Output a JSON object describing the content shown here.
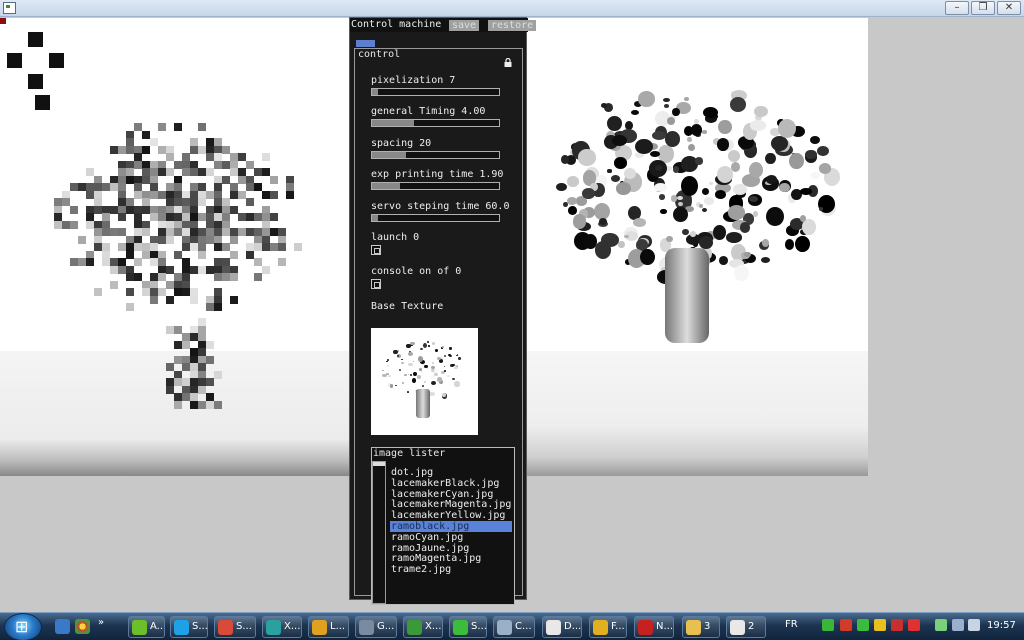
{
  "window": {
    "title": "",
    "controls": {
      "minimize": "–",
      "maximize": "❒",
      "close": "✕"
    }
  },
  "panel": {
    "title": "Control machine",
    "save_label": "save",
    "restore_label": "restore",
    "group_label": "control",
    "controls": [
      {
        "type": "slider",
        "label": "pixelization 7",
        "fraction": 0.05
      },
      {
        "type": "slider",
        "label": "general Timing 4.00",
        "fraction": 0.33
      },
      {
        "type": "slider",
        "label": "spacing 20",
        "fraction": 0.27
      },
      {
        "type": "slider",
        "label": "exp printing time 1.90",
        "fraction": 0.22
      },
      {
        "type": "slider",
        "label": "servo steping time 60.0",
        "fraction": 0.05
      },
      {
        "type": "checkbox",
        "label": "launch 0",
        "checked": false
      },
      {
        "type": "checkbox",
        "label": "console on of 0",
        "checked": false
      }
    ],
    "texture_label": "Base Texture",
    "lister": {
      "label": "image lister",
      "items": [
        "dot.jpg",
        "lacemakerBlack.jpg",
        "lacemakerCyan.jpg",
        "lacemakerMagenta.jpg",
        "lacemakerYellow.jpg",
        "ramoblack.jpg",
        "ramoCyan.jpg",
        "ramoJaune.jpg",
        "ramoMagenta.jpg",
        "trame2.jpg"
      ],
      "selected": "ramoblack.jpg"
    }
  },
  "taskbar": {
    "items": [
      {
        "label": "A...",
        "icon": "dreamweaver-icon",
        "color": "#6bbf2a"
      },
      {
        "label": "S...",
        "icon": "skype-icon",
        "color": "#1ea1e6"
      },
      {
        "label": "S...",
        "icon": "app-icon",
        "color": "#d94a3a"
      },
      {
        "label": "X...",
        "icon": "arduino-icon",
        "color": "#2aa0a0"
      },
      {
        "label": "L...",
        "icon": "media-icon",
        "color": "#e0a020"
      },
      {
        "label": "G...",
        "icon": "app-icon",
        "color": "#7a8aa0"
      },
      {
        "label": "X...",
        "icon": "xcode-icon",
        "color": "#3a9a3a"
      },
      {
        "label": "S...",
        "icon": "spotify-icon",
        "color": "#3cbc3c"
      },
      {
        "label": "C...",
        "icon": "app-icon",
        "color": "#9ab0c8"
      },
      {
        "label": "D...",
        "icon": "document-icon",
        "color": "#e8e8e8"
      },
      {
        "label": "F...",
        "icon": "chrome-icon",
        "color": "#e0b020"
      },
      {
        "label": "N...",
        "icon": "filezilla-icon",
        "color": "#c62020"
      },
      {
        "label": "3",
        "icon": "folder-icon",
        "color": "#e8c050"
      },
      {
        "label": "2",
        "icon": "window-icon",
        "color": "#e8e8e8"
      }
    ],
    "language": "FR",
    "clock": "19:57"
  }
}
